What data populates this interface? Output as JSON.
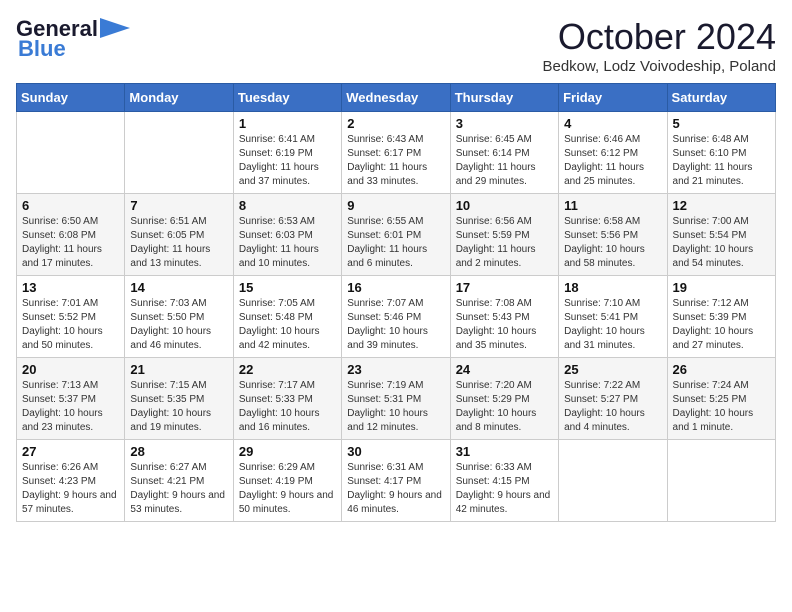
{
  "header": {
    "logo_general": "General",
    "logo_blue": "Blue",
    "title": "October 2024",
    "location": "Bedkow, Lodz Voivodeship, Poland"
  },
  "weekdays": [
    "Sunday",
    "Monday",
    "Tuesday",
    "Wednesday",
    "Thursday",
    "Friday",
    "Saturday"
  ],
  "weeks": [
    [
      {
        "day": "",
        "info": ""
      },
      {
        "day": "",
        "info": ""
      },
      {
        "day": "1",
        "info": "Sunrise: 6:41 AM\nSunset: 6:19 PM\nDaylight: 11 hours and 37 minutes."
      },
      {
        "day": "2",
        "info": "Sunrise: 6:43 AM\nSunset: 6:17 PM\nDaylight: 11 hours and 33 minutes."
      },
      {
        "day": "3",
        "info": "Sunrise: 6:45 AM\nSunset: 6:14 PM\nDaylight: 11 hours and 29 minutes."
      },
      {
        "day": "4",
        "info": "Sunrise: 6:46 AM\nSunset: 6:12 PM\nDaylight: 11 hours and 25 minutes."
      },
      {
        "day": "5",
        "info": "Sunrise: 6:48 AM\nSunset: 6:10 PM\nDaylight: 11 hours and 21 minutes."
      }
    ],
    [
      {
        "day": "6",
        "info": "Sunrise: 6:50 AM\nSunset: 6:08 PM\nDaylight: 11 hours and 17 minutes."
      },
      {
        "day": "7",
        "info": "Sunrise: 6:51 AM\nSunset: 6:05 PM\nDaylight: 11 hours and 13 minutes."
      },
      {
        "day": "8",
        "info": "Sunrise: 6:53 AM\nSunset: 6:03 PM\nDaylight: 11 hours and 10 minutes."
      },
      {
        "day": "9",
        "info": "Sunrise: 6:55 AM\nSunset: 6:01 PM\nDaylight: 11 hours and 6 minutes."
      },
      {
        "day": "10",
        "info": "Sunrise: 6:56 AM\nSunset: 5:59 PM\nDaylight: 11 hours and 2 minutes."
      },
      {
        "day": "11",
        "info": "Sunrise: 6:58 AM\nSunset: 5:56 PM\nDaylight: 10 hours and 58 minutes."
      },
      {
        "day": "12",
        "info": "Sunrise: 7:00 AM\nSunset: 5:54 PM\nDaylight: 10 hours and 54 minutes."
      }
    ],
    [
      {
        "day": "13",
        "info": "Sunrise: 7:01 AM\nSunset: 5:52 PM\nDaylight: 10 hours and 50 minutes."
      },
      {
        "day": "14",
        "info": "Sunrise: 7:03 AM\nSunset: 5:50 PM\nDaylight: 10 hours and 46 minutes."
      },
      {
        "day": "15",
        "info": "Sunrise: 7:05 AM\nSunset: 5:48 PM\nDaylight: 10 hours and 42 minutes."
      },
      {
        "day": "16",
        "info": "Sunrise: 7:07 AM\nSunset: 5:46 PM\nDaylight: 10 hours and 39 minutes."
      },
      {
        "day": "17",
        "info": "Sunrise: 7:08 AM\nSunset: 5:43 PM\nDaylight: 10 hours and 35 minutes."
      },
      {
        "day": "18",
        "info": "Sunrise: 7:10 AM\nSunset: 5:41 PM\nDaylight: 10 hours and 31 minutes."
      },
      {
        "day": "19",
        "info": "Sunrise: 7:12 AM\nSunset: 5:39 PM\nDaylight: 10 hours and 27 minutes."
      }
    ],
    [
      {
        "day": "20",
        "info": "Sunrise: 7:13 AM\nSunset: 5:37 PM\nDaylight: 10 hours and 23 minutes."
      },
      {
        "day": "21",
        "info": "Sunrise: 7:15 AM\nSunset: 5:35 PM\nDaylight: 10 hours and 19 minutes."
      },
      {
        "day": "22",
        "info": "Sunrise: 7:17 AM\nSunset: 5:33 PM\nDaylight: 10 hours and 16 minutes."
      },
      {
        "day": "23",
        "info": "Sunrise: 7:19 AM\nSunset: 5:31 PM\nDaylight: 10 hours and 12 minutes."
      },
      {
        "day": "24",
        "info": "Sunrise: 7:20 AM\nSunset: 5:29 PM\nDaylight: 10 hours and 8 minutes."
      },
      {
        "day": "25",
        "info": "Sunrise: 7:22 AM\nSunset: 5:27 PM\nDaylight: 10 hours and 4 minutes."
      },
      {
        "day": "26",
        "info": "Sunrise: 7:24 AM\nSunset: 5:25 PM\nDaylight: 10 hours and 1 minute."
      }
    ],
    [
      {
        "day": "27",
        "info": "Sunrise: 6:26 AM\nSunset: 4:23 PM\nDaylight: 9 hours and 57 minutes."
      },
      {
        "day": "28",
        "info": "Sunrise: 6:27 AM\nSunset: 4:21 PM\nDaylight: 9 hours and 53 minutes."
      },
      {
        "day": "29",
        "info": "Sunrise: 6:29 AM\nSunset: 4:19 PM\nDaylight: 9 hours and 50 minutes."
      },
      {
        "day": "30",
        "info": "Sunrise: 6:31 AM\nSunset: 4:17 PM\nDaylight: 9 hours and 46 minutes."
      },
      {
        "day": "31",
        "info": "Sunrise: 6:33 AM\nSunset: 4:15 PM\nDaylight: 9 hours and 42 minutes."
      },
      {
        "day": "",
        "info": ""
      },
      {
        "day": "",
        "info": ""
      }
    ]
  ]
}
